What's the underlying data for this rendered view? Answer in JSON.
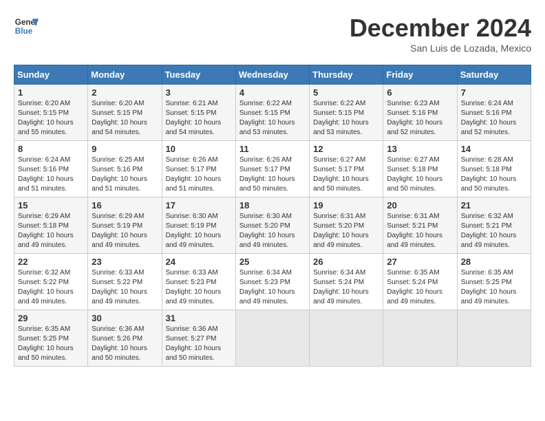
{
  "header": {
    "logo_line1": "General",
    "logo_line2": "Blue",
    "month_title": "December 2024",
    "location": "San Luis de Lozada, Mexico"
  },
  "weekdays": [
    "Sunday",
    "Monday",
    "Tuesday",
    "Wednesday",
    "Thursday",
    "Friday",
    "Saturday"
  ],
  "weeks": [
    [
      {
        "day": 1,
        "sunrise": "6:20 AM",
        "sunset": "5:15 PM",
        "daylight": "10 hours and 55 minutes."
      },
      {
        "day": 2,
        "sunrise": "6:20 AM",
        "sunset": "5:15 PM",
        "daylight": "10 hours and 54 minutes."
      },
      {
        "day": 3,
        "sunrise": "6:21 AM",
        "sunset": "5:15 PM",
        "daylight": "10 hours and 54 minutes."
      },
      {
        "day": 4,
        "sunrise": "6:22 AM",
        "sunset": "5:15 PM",
        "daylight": "10 hours and 53 minutes."
      },
      {
        "day": 5,
        "sunrise": "6:22 AM",
        "sunset": "5:15 PM",
        "daylight": "10 hours and 53 minutes."
      },
      {
        "day": 6,
        "sunrise": "6:23 AM",
        "sunset": "5:16 PM",
        "daylight": "10 hours and 52 minutes."
      },
      {
        "day": 7,
        "sunrise": "6:24 AM",
        "sunset": "5:16 PM",
        "daylight": "10 hours and 52 minutes."
      }
    ],
    [
      {
        "day": 8,
        "sunrise": "6:24 AM",
        "sunset": "5:16 PM",
        "daylight": "10 hours and 51 minutes."
      },
      {
        "day": 9,
        "sunrise": "6:25 AM",
        "sunset": "5:16 PM",
        "daylight": "10 hours and 51 minutes."
      },
      {
        "day": 10,
        "sunrise": "6:26 AM",
        "sunset": "5:17 PM",
        "daylight": "10 hours and 51 minutes."
      },
      {
        "day": 11,
        "sunrise": "6:26 AM",
        "sunset": "5:17 PM",
        "daylight": "10 hours and 50 minutes."
      },
      {
        "day": 12,
        "sunrise": "6:27 AM",
        "sunset": "5:17 PM",
        "daylight": "10 hours and 50 minutes."
      },
      {
        "day": 13,
        "sunrise": "6:27 AM",
        "sunset": "5:18 PM",
        "daylight": "10 hours and 50 minutes."
      },
      {
        "day": 14,
        "sunrise": "6:28 AM",
        "sunset": "5:18 PM",
        "daylight": "10 hours and 50 minutes."
      }
    ],
    [
      {
        "day": 15,
        "sunrise": "6:29 AM",
        "sunset": "5:18 PM",
        "daylight": "10 hours and 49 minutes."
      },
      {
        "day": 16,
        "sunrise": "6:29 AM",
        "sunset": "5:19 PM",
        "daylight": "10 hours and 49 minutes."
      },
      {
        "day": 17,
        "sunrise": "6:30 AM",
        "sunset": "5:19 PM",
        "daylight": "10 hours and 49 minutes."
      },
      {
        "day": 18,
        "sunrise": "6:30 AM",
        "sunset": "5:20 PM",
        "daylight": "10 hours and 49 minutes."
      },
      {
        "day": 19,
        "sunrise": "6:31 AM",
        "sunset": "5:20 PM",
        "daylight": "10 hours and 49 minutes."
      },
      {
        "day": 20,
        "sunrise": "6:31 AM",
        "sunset": "5:21 PM",
        "daylight": "10 hours and 49 minutes."
      },
      {
        "day": 21,
        "sunrise": "6:32 AM",
        "sunset": "5:21 PM",
        "daylight": "10 hours and 49 minutes."
      }
    ],
    [
      {
        "day": 22,
        "sunrise": "6:32 AM",
        "sunset": "5:22 PM",
        "daylight": "10 hours and 49 minutes."
      },
      {
        "day": 23,
        "sunrise": "6:33 AM",
        "sunset": "5:22 PM",
        "daylight": "10 hours and 49 minutes."
      },
      {
        "day": 24,
        "sunrise": "6:33 AM",
        "sunset": "5:23 PM",
        "daylight": "10 hours and 49 minutes."
      },
      {
        "day": 25,
        "sunrise": "6:34 AM",
        "sunset": "5:23 PM",
        "daylight": "10 hours and 49 minutes."
      },
      {
        "day": 26,
        "sunrise": "6:34 AM",
        "sunset": "5:24 PM",
        "daylight": "10 hours and 49 minutes."
      },
      {
        "day": 27,
        "sunrise": "6:35 AM",
        "sunset": "5:24 PM",
        "daylight": "10 hours and 49 minutes."
      },
      {
        "day": 28,
        "sunrise": "6:35 AM",
        "sunset": "5:25 PM",
        "daylight": "10 hours and 49 minutes."
      }
    ],
    [
      {
        "day": 29,
        "sunrise": "6:35 AM",
        "sunset": "5:25 PM",
        "daylight": "10 hours and 50 minutes."
      },
      {
        "day": 30,
        "sunrise": "6:36 AM",
        "sunset": "5:26 PM",
        "daylight": "10 hours and 50 minutes."
      },
      {
        "day": 31,
        "sunrise": "6:36 AM",
        "sunset": "5:27 PM",
        "daylight": "10 hours and 50 minutes."
      },
      null,
      null,
      null,
      null
    ]
  ]
}
